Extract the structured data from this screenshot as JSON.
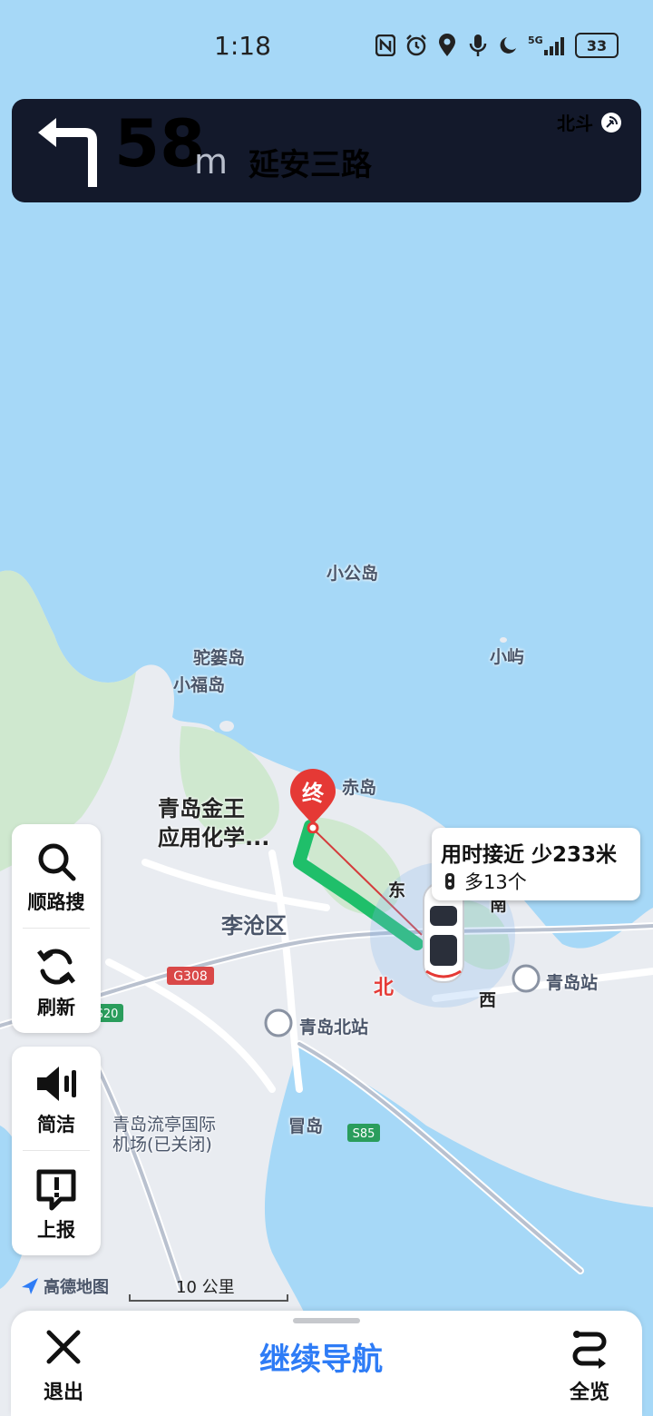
{
  "status_bar": {
    "time": "1:18",
    "network": "5G",
    "battery": "33",
    "icons": [
      "nfc-icon",
      "alarm-icon",
      "location-icon",
      "mic-icon",
      "moon-icon",
      "signal-icon"
    ]
  },
  "navigation": {
    "turn": "left",
    "distance": "58",
    "unit": "m",
    "street": "延安三路",
    "positioning": "北斗"
  },
  "map": {
    "labels": [
      "小公岛",
      "驼篓岛",
      "小屿",
      "小福岛",
      "赤岛",
      "李沧区",
      "青岛站",
      "青岛北站",
      "冒岛",
      "东",
      "南",
      "西",
      "北"
    ],
    "road_badges": [
      "G308",
      "S20",
      "S85"
    ],
    "airport": "青岛流亭国际\n机场(已关闭)",
    "destination_marker": "终",
    "destination_name_line1": "青岛金王",
    "destination_name_line2": "应用化学..."
  },
  "route_tip": {
    "line1": "用时接近 少233米",
    "line2": "多13个"
  },
  "side_buttons": {
    "search": "顺路搜",
    "refresh": "刷新",
    "voice": "简洁",
    "report": "上报"
  },
  "map_footer": {
    "brand": "高德地图",
    "scale": "10 公里"
  },
  "bottom_bar": {
    "exit": "退出",
    "continue": "继续导航",
    "overview": "全览"
  },
  "colors": {
    "water": "#a6d8f7",
    "land": "#e9ecf1",
    "green": "#cfe8cf",
    "route": "#1fbf6a",
    "nav_card": "#13192b",
    "accent": "#2e7cf6"
  }
}
